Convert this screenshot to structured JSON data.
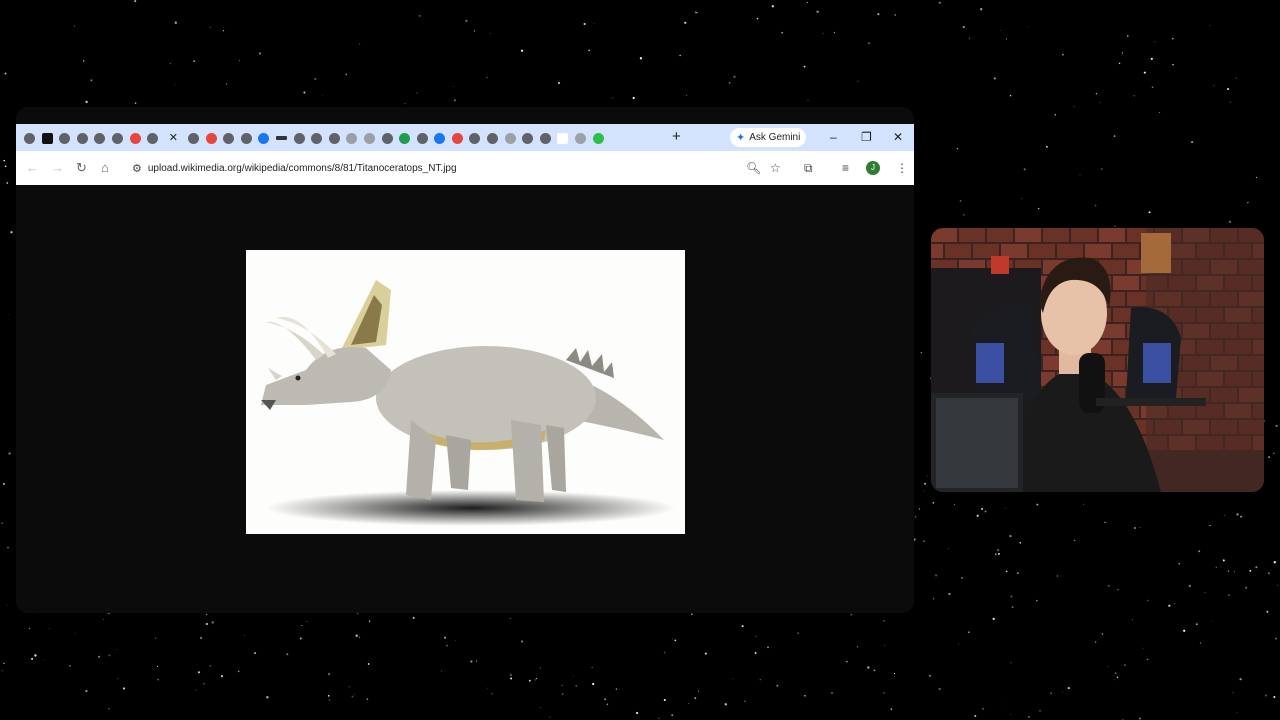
{
  "browser": {
    "tabs": [
      {
        "icon": "generic-globe-icon"
      },
      {
        "icon": "x-logo-icon"
      },
      {
        "icon": "generic-globe-icon"
      },
      {
        "icon": "generic-globe-icon"
      },
      {
        "icon": "generic-globe-icon"
      },
      {
        "icon": "generic-globe-icon"
      },
      {
        "icon": "reddit-icon"
      },
      {
        "icon": "generic-globe-icon"
      },
      {
        "icon": "active-tab-close-icon",
        "active": true
      },
      {
        "icon": "generic-globe-icon"
      },
      {
        "icon": "adobe-icon"
      },
      {
        "icon": "generic-globe-icon"
      },
      {
        "icon": "generic-globe-icon"
      },
      {
        "icon": "facebook-icon"
      },
      {
        "icon": "dash-icon"
      },
      {
        "icon": "generic-globe-icon"
      },
      {
        "icon": "generic-globe-icon"
      },
      {
        "icon": "generic-globe-icon"
      },
      {
        "icon": "wikipedia-icon"
      },
      {
        "icon": "co-icon"
      },
      {
        "icon": "generic-globe-icon"
      },
      {
        "icon": "green-square-icon"
      },
      {
        "icon": "generic-globe-icon"
      },
      {
        "icon": "wordpress-icon"
      },
      {
        "icon": "reddit-icon"
      },
      {
        "icon": "generic-globe-icon"
      },
      {
        "icon": "generic-globe-icon"
      },
      {
        "icon": "image-icon"
      },
      {
        "icon": "generic-globe-icon"
      },
      {
        "icon": "generic-globe-icon"
      },
      {
        "icon": "blank-page-icon"
      },
      {
        "icon": "grey-circle-icon"
      },
      {
        "icon": "green-circle-icon"
      }
    ],
    "new_tab_label": "+",
    "gemini_label": "Ask Gemini",
    "window_controls": {
      "minimize": "–",
      "restore": "❐",
      "close": "✕"
    },
    "nav": {
      "back": "←",
      "forward": "→",
      "reload": "↻",
      "home": "⌂"
    },
    "url": "upload.wikimedia.org/wikipedia/commons/8/81/Titanoceratops_NT.jpg",
    "profile_initial": "J",
    "active_tab_close": "✕"
  },
  "colors": {
    "titlebar": "#d3e3fd",
    "toolbar": "#ffffff",
    "page_background": "#0b0b0b",
    "photo_background": "#fdfdfb"
  },
  "content": {
    "image_subject": "ceratopsian-dinosaur-illustration"
  },
  "webcam": {
    "subject": "streamer-webcam-overlay"
  }
}
